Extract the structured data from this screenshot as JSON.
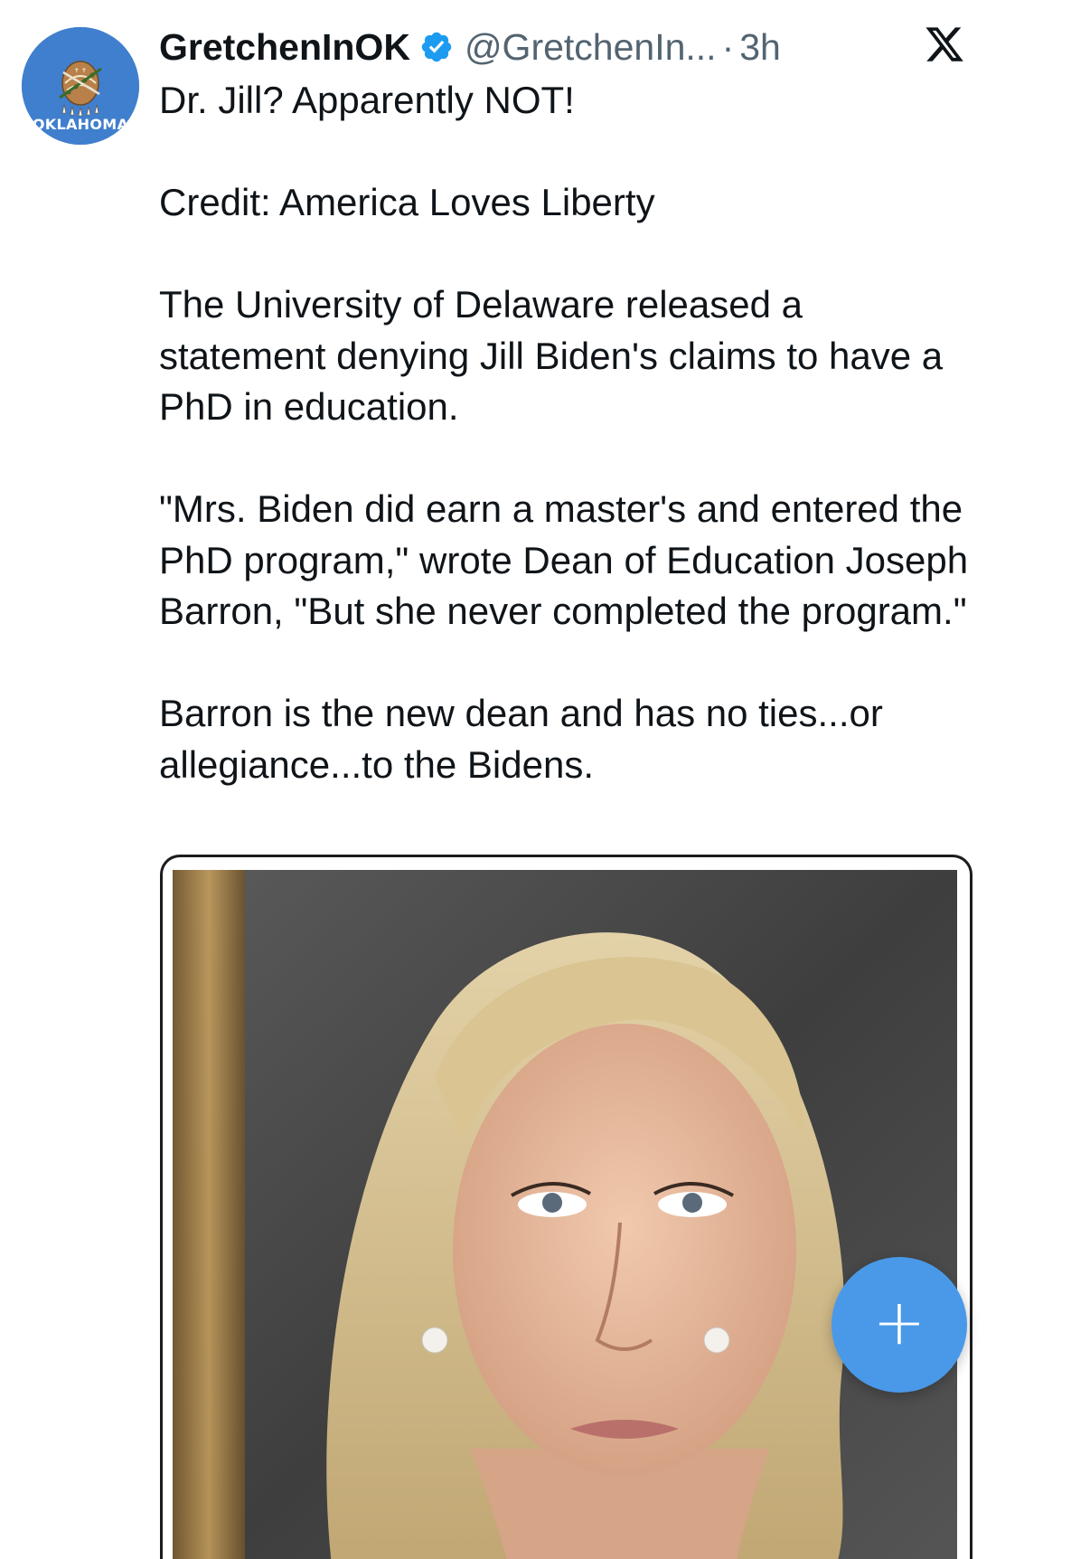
{
  "author": {
    "display_name": "GretchenInOK",
    "handle": "@GretchenIn...",
    "separator": "·",
    "time": "3h",
    "verified": true,
    "avatar": {
      "caption": "OKLAHOMA",
      "background_color": "#3f7fcd",
      "icon": "oklahoma-flag-shield-icon"
    }
  },
  "platform": {
    "logo_icon": "x-logo-icon"
  },
  "tweet": {
    "paragraphs": [
      "Dr. Jill? Apparently NOT!",
      "Credit: America Loves Liberty",
      "The University of Delaware released a statement denying Jill Biden's claims to have a PhD in education.",
      "\"Mrs. Biden did earn a master's and entered the PhD program,\" wrote Dean of Education Joseph Barron, \"But she never completed the program.\"",
      "Barron is the new dean and has no ties...or allegiance...to the Bidens."
    ]
  },
  "media": {
    "type": "photo"
  },
  "compose_button": {
    "symbol": "+",
    "color": "#4a99e9",
    "icon": "plus-icon"
  },
  "colors": {
    "text_primary": "#0f1419",
    "text_secondary": "#536471",
    "verified_blue": "#1d9bf0"
  }
}
